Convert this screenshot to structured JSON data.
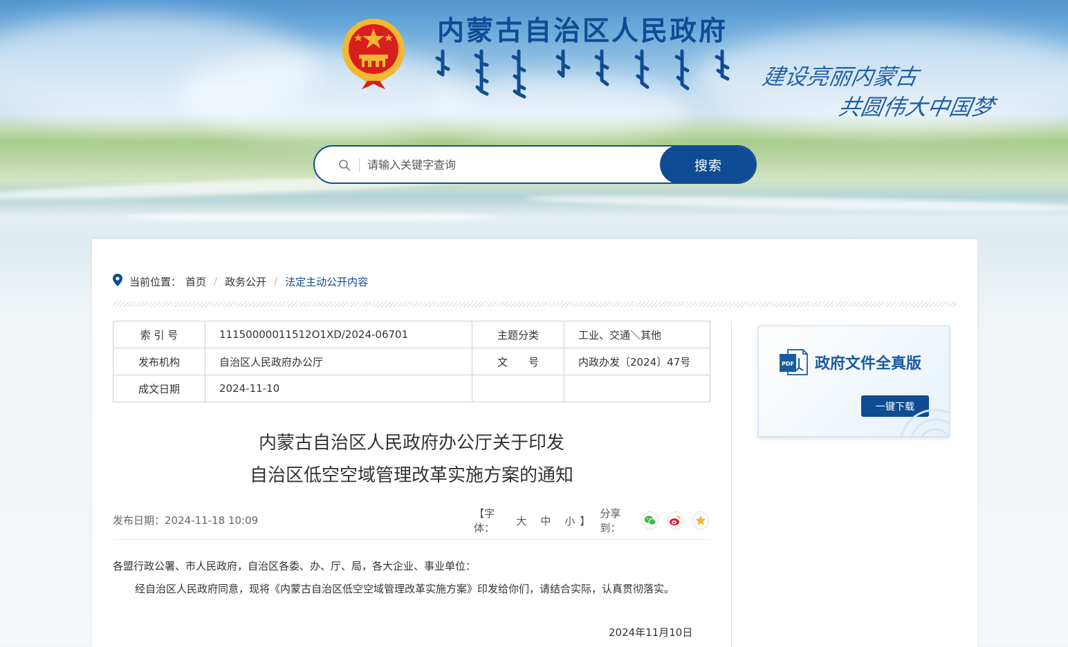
{
  "header": {
    "site_title": "内蒙古自治区人民政府",
    "slogan_line1": "建设亮丽内蒙古",
    "slogan_line2": "共圆伟大中国梦"
  },
  "search": {
    "placeholder": "请输入关键字查询",
    "button_label": "搜索"
  },
  "breadcrumb": {
    "label": "当前位置：",
    "items": [
      "首页",
      "政务公开",
      "法定主动公开内容"
    ]
  },
  "meta": {
    "index_label": "索 引 号",
    "index_value": "11150000011512O1XD/2024-06701",
    "topic_label": "主题分类",
    "topic_value": "工业、交通＼其他",
    "issuer_label": "发布机构",
    "issuer_value": "自治区人民政府办公厅",
    "docno_label": "文　　号",
    "docno_value": "内政办发〔2024〕47号",
    "date_label": "成文日期",
    "date_value": "2024-11-10"
  },
  "article": {
    "title_line1": "内蒙古自治区人民政府办公厅关于印发",
    "title_line2": "自治区低空空域管理改革实施方案的通知",
    "publish": "发布日期：2024-11-18 10:09",
    "font_open": "【字体：",
    "font_large": "大",
    "font_medium": "中",
    "font_small": "小",
    "font_close": "】",
    "share_label": "分享到：",
    "para1": "各盟行政公署、市人民政府，自治区各委、办、厅、局，各大企业、事业单位：",
    "para2": "经自治区人民政府同意，现将《内蒙古自治区低空空域管理改革实施方案》印发给你们，请结合实际，认真贯彻落实。",
    "sign_date": "2024年11月10日"
  },
  "pdf_card": {
    "title": "政府文件全真版",
    "button": "一键下载"
  },
  "colors": {
    "primary": "#0f4c93",
    "emblem_red": "#d81e1e",
    "emblem_gold": "#f2b733"
  }
}
